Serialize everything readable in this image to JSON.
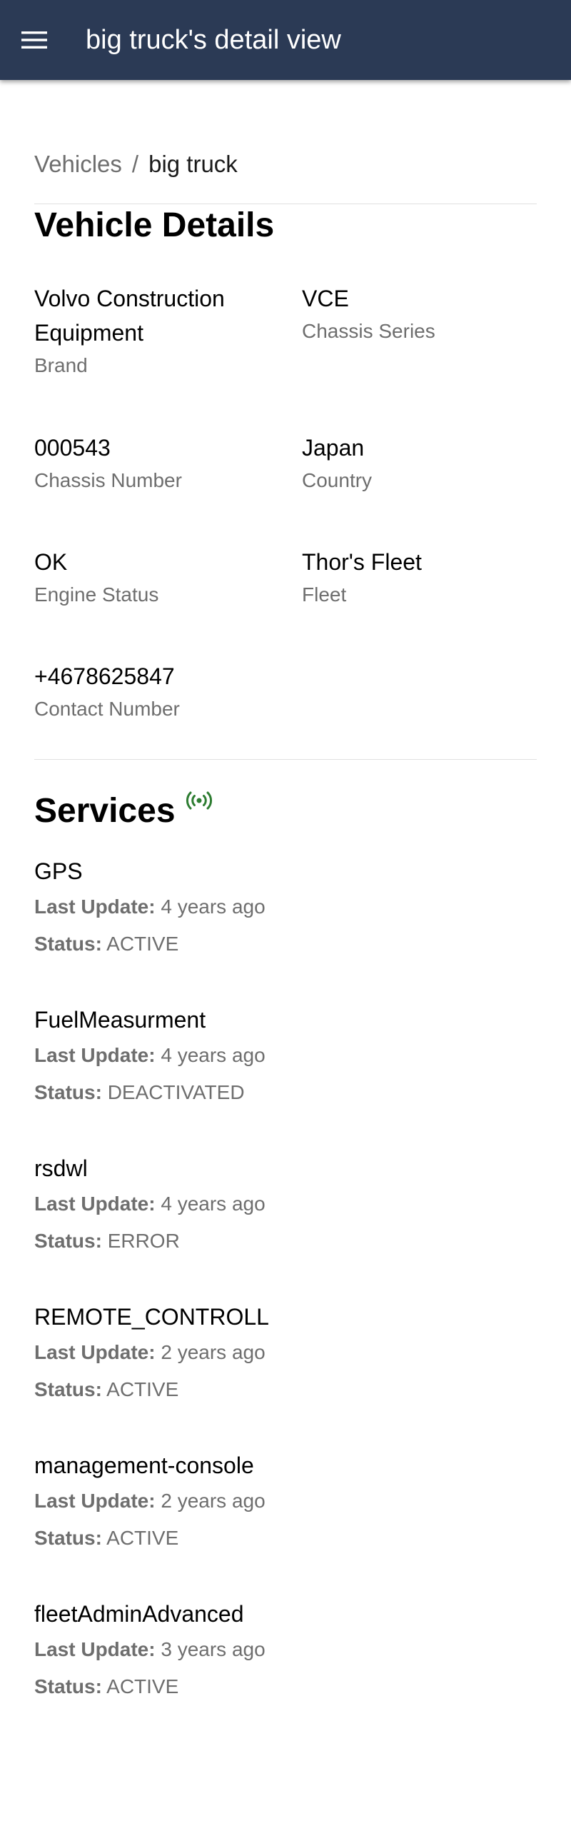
{
  "header": {
    "title": "big truck's detail view",
    "menu_icon": "menu-icon"
  },
  "breadcrumb": {
    "parent": "Vehicles",
    "separator": "/",
    "current": "big truck"
  },
  "details": {
    "title": "Vehicle Details",
    "brand": {
      "value": "Volvo Construction Equipment",
      "label": "Brand"
    },
    "chassis_series": {
      "value": "VCE",
      "label": "Chassis Series"
    },
    "chassis_number": {
      "value": "000543",
      "label": "Chassis Number"
    },
    "country": {
      "value": "Japan",
      "label": "Country"
    },
    "engine_status": {
      "value": "OK",
      "label": "Engine Status"
    },
    "fleet": {
      "value": "Thor's Fleet",
      "label": "Fleet"
    },
    "contact_number": {
      "value": "+4678625847",
      "label": "Contact Number"
    }
  },
  "services": {
    "title": "Services",
    "live_icon": "live-signal-icon",
    "live_icon_color": "#2e7d32",
    "last_update_label": "Last Update:",
    "status_label": "Status:",
    "items": [
      {
        "name": "GPS",
        "last_update": "4 years ago",
        "status": "ACTIVE"
      },
      {
        "name": "FuelMeasurment",
        "last_update": "4 years ago",
        "status": "DEACTIVATED"
      },
      {
        "name": "rsdwl",
        "last_update": "4 years ago",
        "status": "ERROR"
      },
      {
        "name": "REMOTE_CONTROLL",
        "last_update": "2 years ago",
        "status": "ACTIVE"
      },
      {
        "name": "management-console",
        "last_update": "2 years ago",
        "status": "ACTIVE"
      },
      {
        "name": "fleetAdminAdvanced",
        "last_update": "3 years ago",
        "status": "ACTIVE"
      }
    ]
  },
  "colors": {
    "appbar": "#2b3a55",
    "secondary_text": "#6e6e6e"
  }
}
